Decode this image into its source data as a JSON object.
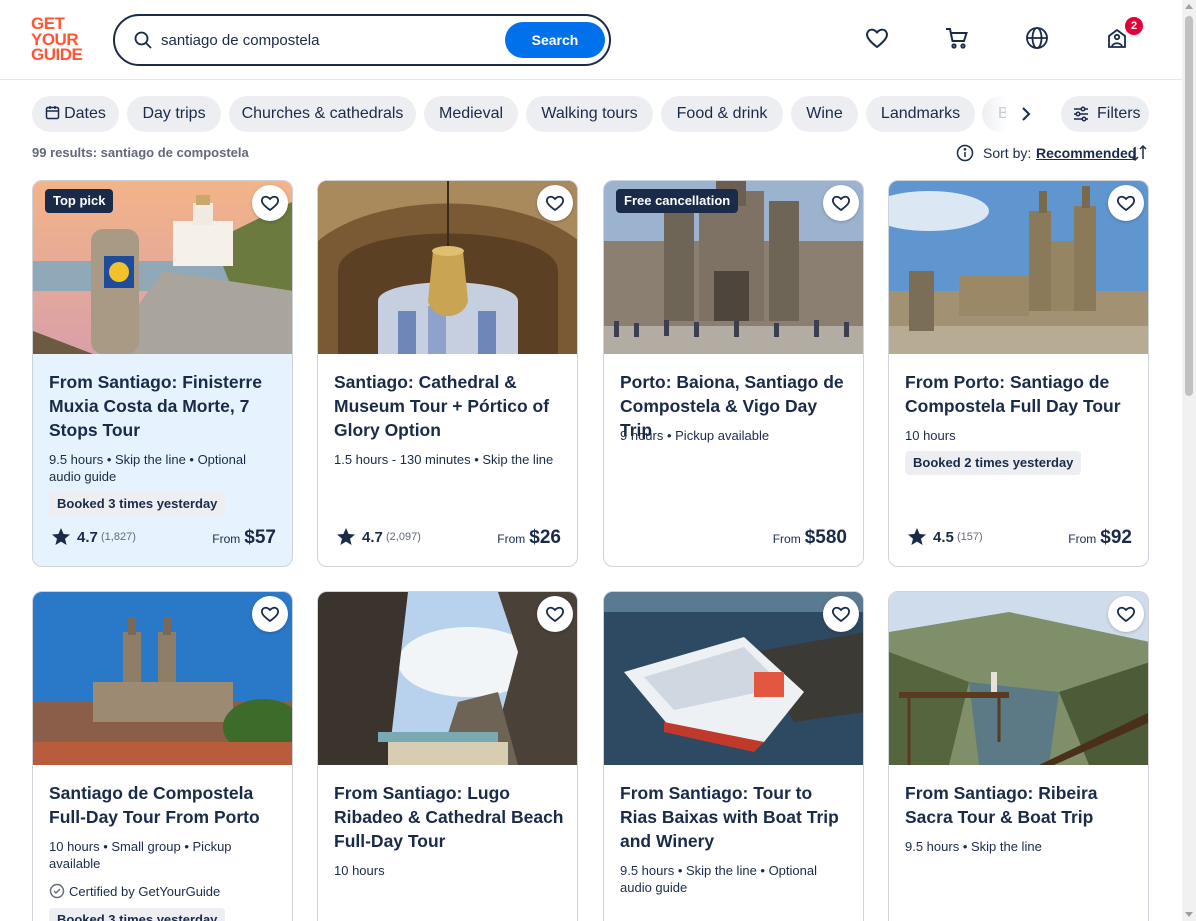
{
  "header": {
    "logo_lines": [
      "GET",
      "YOUR",
      "GUIDE"
    ],
    "search_value": "santiago de compostela",
    "search_button": "Search",
    "notification_count": "2"
  },
  "chips": [
    {
      "label": "Dates",
      "icon": "calendar-icon"
    },
    {
      "label": "Day trips"
    },
    {
      "label": "Churches & cathedrals"
    },
    {
      "label": "Medieval"
    },
    {
      "label": "Walking tours"
    },
    {
      "label": "Food & drink"
    },
    {
      "label": "Wine"
    },
    {
      "label": "Landmarks"
    },
    {
      "label": "B"
    }
  ],
  "filters_label": "Filters",
  "results_text": "99 results: santiago de compostela",
  "sort": {
    "label": "Sort by:",
    "value": "Recommended"
  },
  "cards": [
    {
      "tag": "Top pick",
      "title": "From Santiago: Finisterre Muxia Costa da Morte, 7 Stops Tour",
      "meta": "9.5 hours • Skip the line • Optional audio guide",
      "booked": "Booked 3 times yesterday",
      "rating": "4.7",
      "reviews": "(1,827)",
      "from": "From",
      "price": "$57"
    },
    {
      "title": "Santiago: Cathedral & Museum Tour + Pórtico of Glory Option",
      "meta": "1.5 hours - 130 minutes • Skip the line",
      "rating": "4.7",
      "reviews": "(2,097)",
      "from": "From",
      "price": "$26"
    },
    {
      "tag": "Free cancellation",
      "title": "Porto: Baiona, Santiago de Compostela & Vigo Day Trip",
      "meta": "9 hours • Pickup available",
      "from": "From",
      "price": "$580"
    },
    {
      "title": "From Porto: Santiago de Compostela Full Day Tour",
      "meta": "10 hours",
      "booked": "Booked 2 times yesterday",
      "rating": "4.5",
      "reviews": "(157)",
      "from": "From",
      "price": "$92"
    },
    {
      "title": "Santiago de Compostela Full-Day Tour From Porto",
      "meta": "10 hours • Small group • Pickup available",
      "certified": "Certified by GetYourGuide",
      "booked": "Booked 3 times yesterday"
    },
    {
      "title": "From Santiago: Lugo Ribadeo & Cathedral Beach Full-Day Tour",
      "meta": "10 hours"
    },
    {
      "title": "From Santiago: Tour to Rias Baixas with Boat Trip and Winery",
      "meta": "9.5 hours • Skip the line • Optional audio guide"
    },
    {
      "title": "From Santiago: Ribeira Sacra Tour & Boat Trip",
      "meta": "9.5 hours • Skip the line"
    }
  ],
  "colors": {
    "brand": "#ff5533",
    "accent": "#0071eb",
    "ink": "#1a2b49",
    "highlight": "#e6f2fd"
  }
}
